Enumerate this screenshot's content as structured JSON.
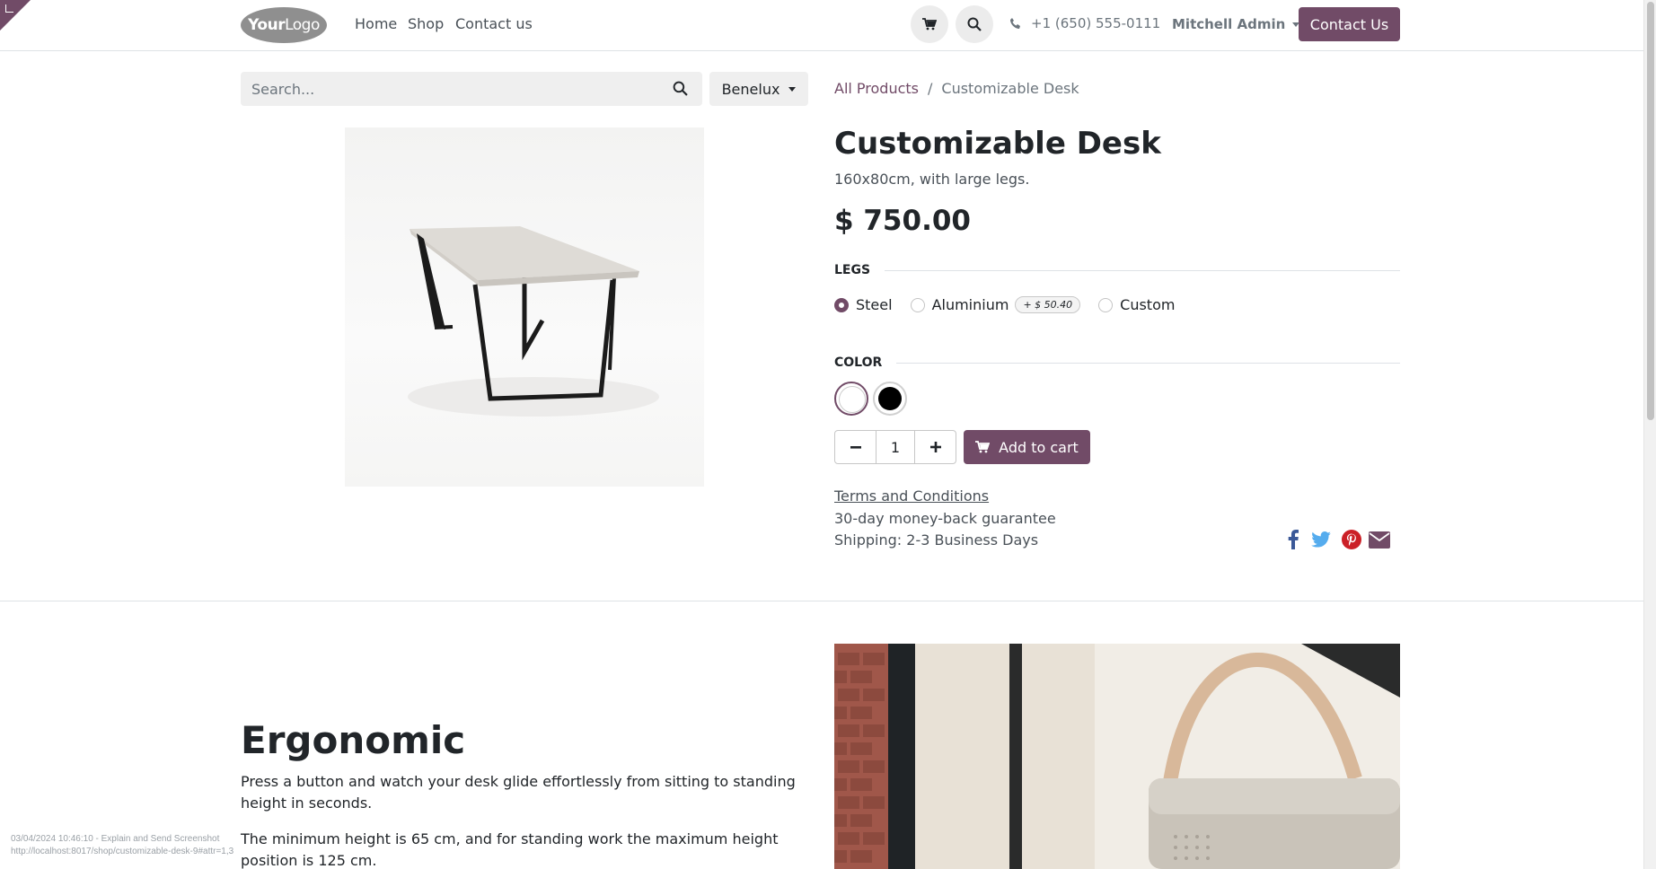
{
  "header": {
    "logo_text_bold": "Your",
    "logo_text_light": "Logo",
    "nav": [
      "Home",
      "Shop",
      "Contact us"
    ],
    "phone": "+1 (650) 555-0111",
    "user": "Mitchell Admin",
    "contact_button": "Contact Us",
    "icons": [
      "cart-icon",
      "search-icon",
      "phone-icon",
      "chevron-down-icon"
    ]
  },
  "search": {
    "placeholder": "Search...",
    "value": ""
  },
  "pricelist": {
    "selected": "Benelux"
  },
  "breadcrumb": {
    "parent": "All Products",
    "separator": "/",
    "current": "Customizable Desk"
  },
  "product": {
    "name": "Customizable Desk",
    "description": "160x80cm, with large legs.",
    "price": "$ 750.00",
    "image": "desk-product-image"
  },
  "attributes": {
    "legs": {
      "label": "LEGS",
      "options": [
        {
          "label": "Steel",
          "checked": true,
          "extra": ""
        },
        {
          "label": "Aluminium",
          "checked": false,
          "extra": "+ $ 50.40"
        },
        {
          "label": "Custom",
          "checked": false,
          "extra": ""
        }
      ]
    },
    "color": {
      "label": "COLOR",
      "swatches": [
        {
          "color": "#ffffff",
          "selected": true
        },
        {
          "color": "#000000",
          "selected": false
        }
      ]
    }
  },
  "cart": {
    "quantity": "1",
    "minus": "−",
    "plus": "+",
    "add_label": "Add to cart"
  },
  "info": {
    "terms": "Terms and Conditions",
    "guarantee": "30-day money-back guarantee",
    "shipping": "Shipping: 2-3 Business Days"
  },
  "share_icons": [
    "facebook-icon",
    "twitter-icon",
    "pinterest-icon",
    "envelope-icon"
  ],
  "colors": {
    "brand": "#714b67",
    "facebook": "#3b5998",
    "twitter": "#55acee",
    "pinterest": "#cb2027",
    "email": "#714b67"
  },
  "lower_section": {
    "title": "Ergonomic",
    "paragraph_1": "Press a button and watch your desk glide effortlessly from sitting to standing height in seconds.",
    "paragraph_2": "The minimum height is 65 cm, and for standing work the maximum height position is 125 cm."
  },
  "overlay": {
    "line_1": "03/04/2024 10:46:10 - Explain and Send Screenshot",
    "line_2": "http://localhost:8017/shop/customizable-desk-9#attr=1,3"
  }
}
